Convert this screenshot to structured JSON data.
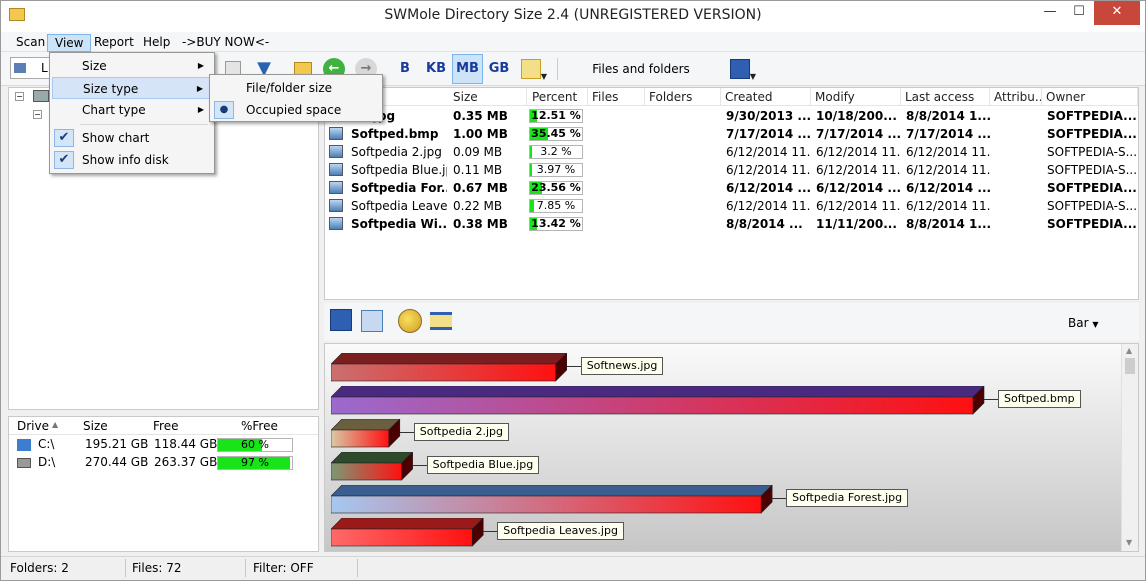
{
  "app": {
    "title": "SWMole Directory Size 2.4 (UNREGISTERED VERSION)"
  },
  "window_buttons": {
    "minimize": "—",
    "maximize": "☐",
    "close": "✕"
  },
  "menubar": [
    "Scan",
    "View",
    "Report",
    "Help",
    "->BUY NOW<-"
  ],
  "toolbar": {
    "units": [
      "B",
      "KB",
      "MB",
      "GB"
    ],
    "active_unit": "MB",
    "files_folders_label": "Files and folders",
    "drive_combo_text": "L"
  },
  "view_menu": {
    "items": [
      {
        "label": "Size",
        "submenu": true,
        "checked": false
      },
      {
        "label": "Size type",
        "submenu": true,
        "checked": false,
        "highlighted": true
      },
      {
        "label": "Chart type",
        "submenu": true,
        "checked": false
      },
      {
        "label": "Show chart",
        "submenu": false,
        "checked": true
      },
      {
        "label": "Show info disk",
        "submenu": false,
        "checked": true
      }
    ]
  },
  "size_type_submenu": {
    "items": [
      {
        "label": "File/folder size",
        "selected": false
      },
      {
        "label": "Occupied space",
        "selected": true
      }
    ]
  },
  "file_list": {
    "columns": [
      "Size",
      "Percent",
      "Files",
      "Folders",
      "Created",
      "Modify",
      "Last access",
      "Attribu...",
      "Owner"
    ],
    "rows": [
      {
        "name": "ws.jpg",
        "bold": true,
        "size": "0.35 MB",
        "percent": "12.51 %",
        "pct": 12.51,
        "created": "9/30/2013 ...",
        "modify": "10/18/200...",
        "access": "8/8/2014 1...",
        "owner": "SOFTPEDIA..."
      },
      {
        "name": "Softped.bmp",
        "bold": true,
        "size": "1.00 MB",
        "percent": "35.45 %",
        "pct": 35.45,
        "created": "7/17/2014 ...",
        "modify": "7/17/2014 ...",
        "access": "7/17/2014 ...",
        "owner": "SOFTPEDIA..."
      },
      {
        "name": "Softpedia 2.jpg",
        "bold": false,
        "size": "0.09 MB",
        "percent": "3.2 %",
        "pct": 3.2,
        "created": "6/12/2014 11...",
        "modify": "6/12/2014 11...",
        "access": "6/12/2014 11...",
        "owner": "SOFTPEDIA-S..."
      },
      {
        "name": "Softpedia Blue.jpg",
        "bold": false,
        "size": "0.11 MB",
        "percent": "3.97 %",
        "pct": 3.97,
        "created": "6/12/2014 11...",
        "modify": "6/12/2014 11...",
        "access": "6/12/2014 11...",
        "owner": "SOFTPEDIA-S..."
      },
      {
        "name": "Softpedia For...",
        "bold": true,
        "size": "0.67 MB",
        "percent": "23.56 %",
        "pct": 23.56,
        "created": "6/12/2014 ...",
        "modify": "6/12/2014 ...",
        "access": "6/12/2014 ...",
        "owner": "SOFTPEDIA..."
      },
      {
        "name": "Softpedia Leave...",
        "bold": false,
        "size": "0.22 MB",
        "percent": "7.85 %",
        "pct": 7.85,
        "created": "6/12/2014 11...",
        "modify": "6/12/2014 11...",
        "access": "6/12/2014 11...",
        "owner": "SOFTPEDIA-S..."
      },
      {
        "name": "Softpedia Wi...",
        "bold": true,
        "size": "0.38 MB",
        "percent": "13.42 %",
        "pct": 13.42,
        "created": "8/8/2014 ...",
        "modify": "11/11/200...",
        "access": "8/8/2014 1...",
        "owner": "SOFTPEDIA..."
      }
    ]
  },
  "drives": {
    "columns": [
      "Drive",
      "Size",
      "Free",
      "%Free"
    ],
    "rows": [
      {
        "drive": "C:\\",
        "size": "195.21 GB",
        "free": "118.44 GB",
        "pfree": "60 %",
        "pct": 60
      },
      {
        "drive": "D:\\",
        "size": "270.44 GB",
        "free": "263.37 GB",
        "pfree": "97 %",
        "pct": 97
      }
    ]
  },
  "chart_toolbar": {
    "type_label": "Bar"
  },
  "chart_data": {
    "type": "bar",
    "categories": [
      "Softnews.jpg",
      "Softped.bmp",
      "Softpedia 2.jpg",
      "Softpedia Blue.jpg",
      "Softpedia Forest.jpg",
      "Softpedia Leaves.jpg"
    ],
    "values": [
      0.35,
      1.0,
      0.09,
      0.11,
      0.67,
      0.22
    ],
    "colors": [
      [
        "#c97070",
        "#ff1010",
        "#7a1f1f"
      ],
      [
        "#9a6ad0",
        "#ff1010",
        "#4a2a80"
      ],
      [
        "#d8c9a6",
        "#ff1010",
        "#6a6040"
      ],
      [
        "#7a9a76",
        "#ff1010",
        "#2e4a2a"
      ],
      [
        "#a6c8f0",
        "#ff1010",
        "#3a5e90"
      ],
      [
        "#ff6a6a",
        "#ff1010",
        "#9a1a1a"
      ]
    ]
  },
  "status": {
    "folders": "Folders: 2",
    "files": "Files: 72",
    "filter": "Filter: OFF"
  }
}
